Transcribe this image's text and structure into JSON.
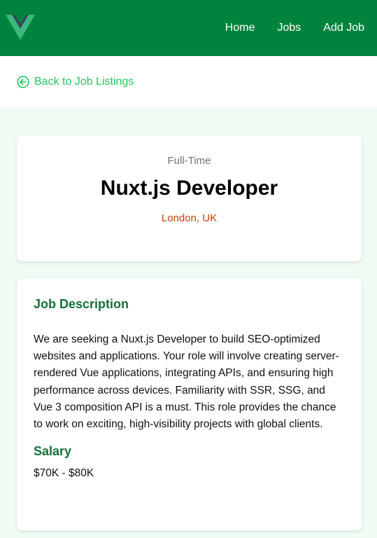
{
  "nav": {
    "logo": "vue-logo",
    "links": [
      "Home",
      "Jobs",
      "Add Job"
    ]
  },
  "back": {
    "icon": "arrow-circle-left-icon",
    "label": "Back to Job Listings"
  },
  "job": {
    "type": "Full-Time",
    "title": "Nuxt.js Developer",
    "location": "London, UK",
    "description_heading": "Job Description",
    "description": "We are seeking a Nuxt.js Developer to build SEO-optimized websites and applications. Your role will involve creating server-rendered Vue applications, integrating APIs, and ensuring high performance across devices. Familiarity with SSR, SSG, and Vue 3 composition API is a must. This role provides the chance to work on exciting, high-visibility projects with global clients.",
    "salary_heading": "Salary",
    "salary": "$70K - $80K"
  },
  "colors": {
    "nav_bg": "#00843d",
    "accent": "#22c55e",
    "location": "#c2410c",
    "heading": "#14703b",
    "page_bg": "#effbf3"
  }
}
